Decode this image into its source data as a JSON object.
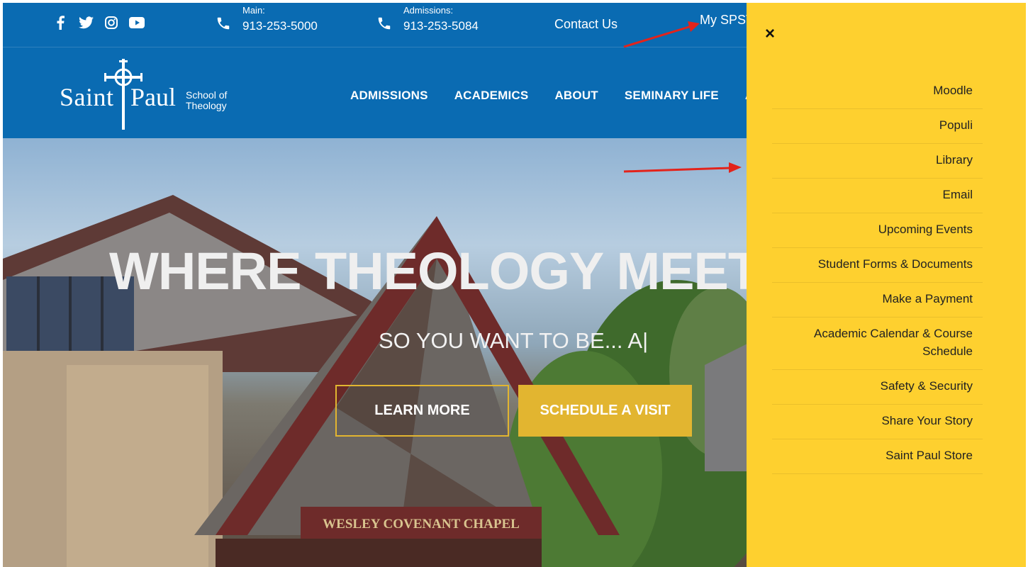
{
  "topbar": {
    "social_icons": [
      "facebook-icon",
      "twitter-icon",
      "instagram-icon",
      "youtube-icon"
    ],
    "main_label": "Main:",
    "main_number": "913-253-5000",
    "admissions_label": "Admissions:",
    "admissions_number": "913-253-5084",
    "contact": "Contact Us",
    "myspst": "My SPST"
  },
  "logo": {
    "saint": "Saint",
    "paul": "Paul",
    "school_line1": "School of",
    "school_line2": "Theology"
  },
  "nav": [
    "ADMISSIONS",
    "ACADEMICS",
    "ABOUT",
    "SEMINARY LIFE",
    "A"
  ],
  "hero": {
    "title": "WHERE THEOLOGY MEET",
    "subtitle": "SO YOU WANT TO BE... A|",
    "learn_more": "LEARN MORE",
    "schedule_visit": "SCHEDULE A VISIT",
    "chapel_sign": "WESLEY COVENANT CHAPEL"
  },
  "drawer": {
    "close": "×",
    "items": [
      "Moodle",
      "Populi",
      "Library",
      "Email",
      "Upcoming Events",
      "Student Forms & Documents",
      "Make a Payment",
      "Academic Calendar & Course Schedule",
      "Safety & Security",
      "Share Your Story",
      "Saint Paul Store"
    ]
  },
  "colors": {
    "brand_blue": "#0a6bb2",
    "drawer_yellow": "#fed02f",
    "accent_gold": "#e2b530",
    "annotation_red": "#e3231b"
  }
}
